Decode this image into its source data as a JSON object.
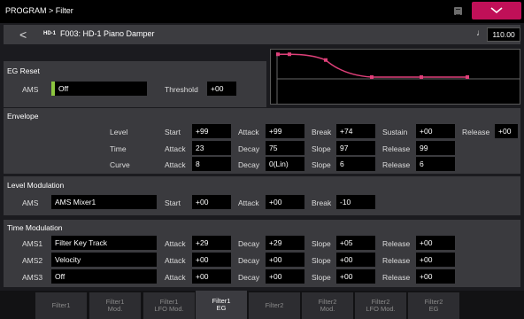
{
  "app": {
    "title": "PROGRAM > Filter"
  },
  "program": {
    "badge": "HD-1",
    "name": "F003: HD-1 Piano Damper",
    "tempo": "110.00"
  },
  "eg_reset": {
    "heading": "EG Reset",
    "ams_label": "AMS",
    "ams_value": "Off",
    "threshold_label": "Threshold",
    "threshold_value": "+00"
  },
  "eg_graph": {
    "levels": [
      0.99,
      0.99,
      0.74,
      0.0,
      0.0,
      0.0
    ]
  },
  "envelope": {
    "heading": "Envelope",
    "row_labels": {
      "level": "Level",
      "time": "Time",
      "curve": "Curve"
    },
    "level": {
      "start_label": "Start",
      "start": "+99",
      "attack_label": "Attack",
      "attack": "+99",
      "break_label": "Break",
      "break": "+74",
      "sustain_label": "Sustain",
      "sustain": "+00",
      "release_label": "Release",
      "release": "+00"
    },
    "time": {
      "attack_label": "Attack",
      "attack": "23",
      "decay_label": "Decay",
      "decay": "75",
      "slope_label": "Slope",
      "slope": "97",
      "release_label": "Release",
      "release": "99"
    },
    "curve": {
      "attack_label": "Attack",
      "attack": "8",
      "decay_label": "Decay",
      "decay": "0(Lin)",
      "slope_label": "Slope",
      "slope": "6",
      "release_label": "Release",
      "release": "6"
    }
  },
  "level_mod": {
    "heading": "Level Modulation",
    "ams_label": "AMS",
    "ams_value": "AMS Mixer1",
    "start_label": "Start",
    "start": "+00",
    "attack_label": "Attack",
    "attack": "+00",
    "break_label": "Break",
    "break": "-10"
  },
  "time_mod": {
    "heading": "Time Modulation",
    "rows": [
      {
        "label": "AMS1",
        "source": "Filter Key Track",
        "attack_label": "Attack",
        "attack": "+29",
        "decay_label": "Decay",
        "decay": "+29",
        "slope_label": "Slope",
        "slope": "+05",
        "release_label": "Release",
        "release": "+00"
      },
      {
        "label": "AMS2",
        "source": "Velocity",
        "attack_label": "Attack",
        "attack": "+00",
        "decay_label": "Decay",
        "decay": "+00",
        "slope_label": "Slope",
        "slope": "+00",
        "release_label": "Release",
        "release": "+00"
      },
      {
        "label": "AMS3",
        "source": "Off",
        "attack_label": "Attack",
        "attack": "+00",
        "decay_label": "Decay",
        "decay": "+00",
        "slope_label": "Slope",
        "slope": "+00",
        "release_label": "Release",
        "release": "+00"
      }
    ]
  },
  "tabs": [
    {
      "line1": "Filter1",
      "line2": ""
    },
    {
      "line1": "Filter1",
      "line2": "Mod."
    },
    {
      "line1": "Filter1",
      "line2": "LFO Mod."
    },
    {
      "line1": "Filter1",
      "line2": "EG"
    },
    {
      "line1": "Filter2",
      "line2": ""
    },
    {
      "line1": "Filter2",
      "line2": "Mod."
    },
    {
      "line1": "Filter2",
      "line2": "LFO Mod."
    },
    {
      "line1": "Filter2",
      "line2": "EG"
    }
  ],
  "active_tab": 3,
  "colors": {
    "accent": "#c01058",
    "eg_line": "#e0407a",
    "indicator": "#8cc63f"
  }
}
